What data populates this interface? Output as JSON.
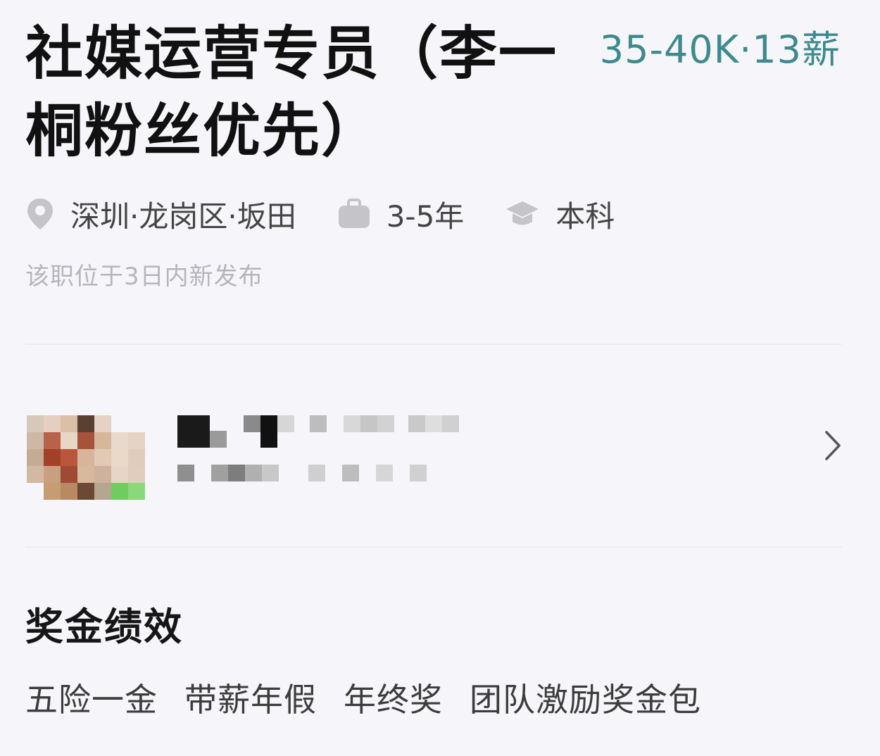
{
  "job": {
    "title_line1": "社媒运营专员（李一",
    "title_line2": "桐粉丝优先）",
    "salary": "35-40K·13薪",
    "location": "深圳·龙岗区·坂田",
    "experience": "3-5年",
    "education": "本科",
    "posted_note": "该职位于3日内新发布",
    "icons": {
      "location": "location-pin-icon",
      "experience": "briefcase-icon",
      "education": "graduation-cap-icon"
    }
  },
  "recruiter": {
    "avatar": "pixelated-avatar",
    "name": "",
    "title": "",
    "chevron": "chevron-right-icon"
  },
  "benefits": {
    "title": "奖金绩效",
    "tags": [
      "五险一金",
      "带薪年假",
      "年终奖",
      "团队激励奖金包"
    ]
  },
  "colors": {
    "salary": "#3d8a8f",
    "title": "#111111",
    "background": "#f6f6fa",
    "muted": "#b5b5bb"
  }
}
